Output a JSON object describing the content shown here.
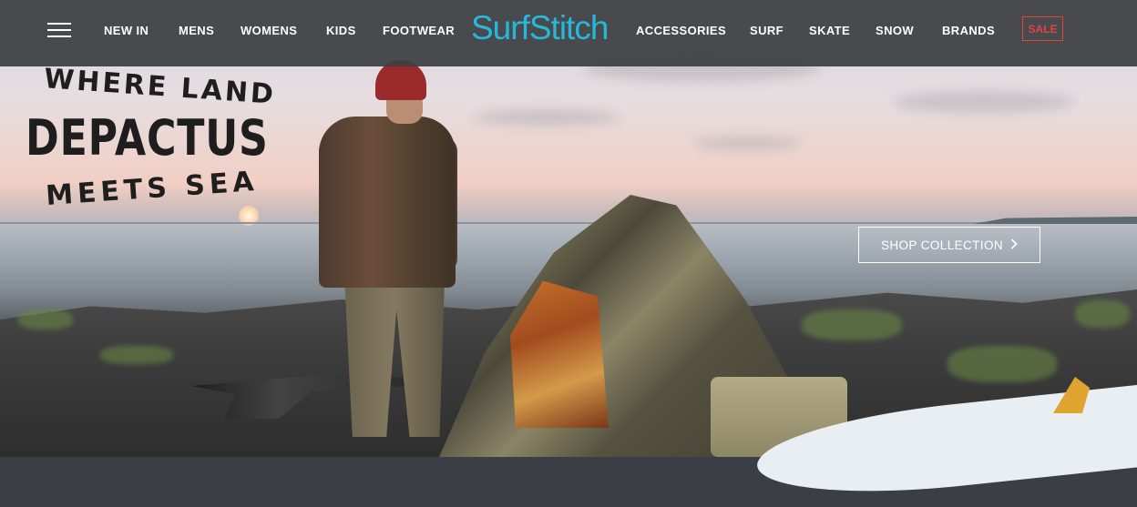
{
  "nav": {
    "menu_icon": "hamburger-menu-icon",
    "links_left": [
      "NEW IN",
      "MENS",
      "WOMENS",
      "KIDS",
      "FOOTWEAR"
    ],
    "logo": "SurfStitch",
    "links_right": [
      "ACCESSORIES",
      "SURF",
      "SKATE",
      "SNOW",
      "BRANDS"
    ],
    "sale_label": "SALE",
    "sale_color": "#e0463d",
    "logo_color": "#27b7d8"
  },
  "hero": {
    "tagline_line1": "WHERE LAND",
    "tagline_line2": "DEPACTUS",
    "tagline_line3": "MEETS SEA",
    "cta_label": "SHOP COLLECTION",
    "cta_icon": "chevron-right-icon"
  }
}
